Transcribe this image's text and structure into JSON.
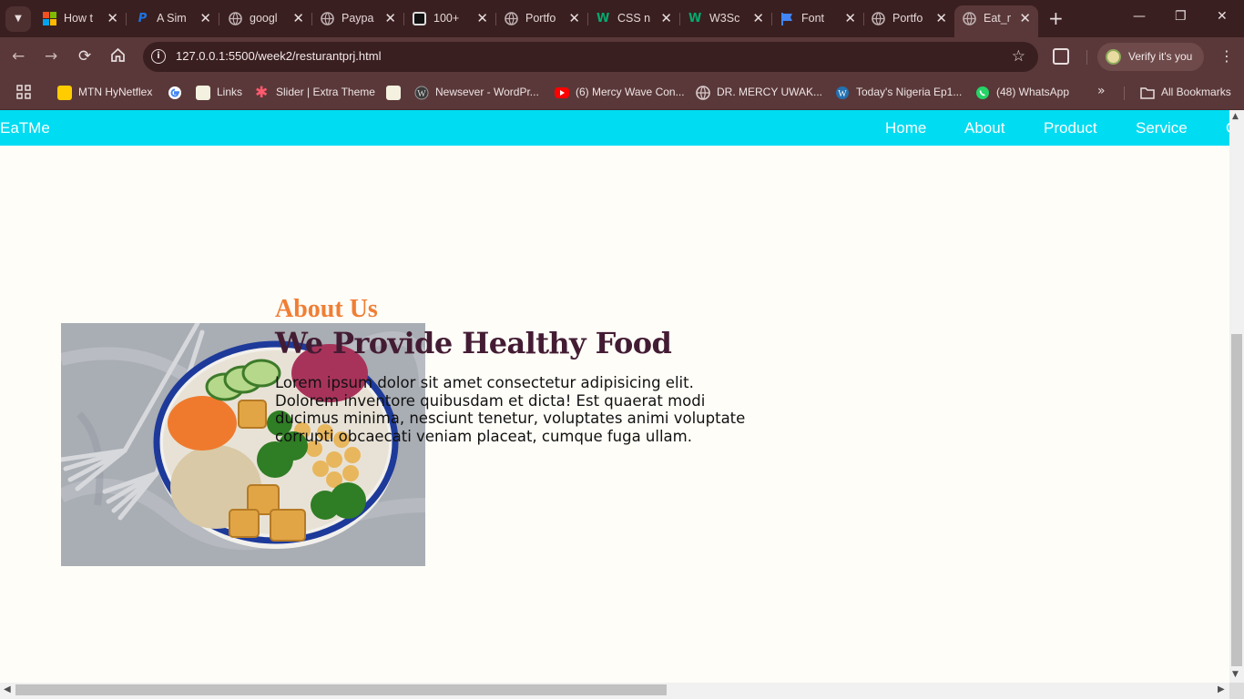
{
  "browser": {
    "tabs": [
      {
        "title": "How t",
        "favicon": "microsoft-icon",
        "color": "#f25022"
      },
      {
        "title": "A Sim",
        "favicon": "paypal-icon",
        "color": "#1b74e4"
      },
      {
        "title": "googl",
        "favicon": "globe-icon",
        "color": "#9e9e9e"
      },
      {
        "title": "Paypa",
        "favicon": "globe-icon",
        "color": "#9e9e9e"
      },
      {
        "title": "100+",
        "favicon": "site-icon",
        "color": "#111111"
      },
      {
        "title": "Portfo",
        "favicon": "globe-icon",
        "color": "#9e9e9e"
      },
      {
        "title": "CSS n",
        "favicon": "w3schools-icon",
        "color": "#04aa6d"
      },
      {
        "title": "W3Sc",
        "favicon": "w3schools-icon",
        "color": "#04aa6d"
      },
      {
        "title": "Font",
        "favicon": "flag-icon",
        "color": "#4285f4"
      },
      {
        "title": "Portfo",
        "favicon": "globe-icon",
        "color": "#9e9e9e"
      },
      {
        "title": "Eat_m",
        "favicon": "globe-icon",
        "color": "#9e9e9e",
        "active": true
      }
    ],
    "url": "127.0.0.1:5500/week2/resturantprj.html",
    "verify_label": "Verify it's you",
    "bookmarks": [
      {
        "label": "MTN HyNetflex",
        "icon": "mtn-icon",
        "color": "#ffcc00"
      },
      {
        "label": "",
        "icon": "google-icon",
        "color": "#ffffff"
      },
      {
        "label": "Links",
        "icon": "page-icon",
        "color": "#f4f1e0"
      },
      {
        "label": "Slider | Extra Theme",
        "icon": "asterisk-icon",
        "color": "#ff5a6e"
      },
      {
        "label": "",
        "icon": "page-icon",
        "color": "#f4f1e0"
      },
      {
        "label": "Newsever - WordPr...",
        "icon": "wordpress-icon",
        "color": "#3a3a3a"
      },
      {
        "label": "(6) Mercy Wave Con...",
        "icon": "youtube-icon",
        "color": "#ff0000"
      },
      {
        "label": "DR. MERCY UWAK...",
        "icon": "globe-icon",
        "color": "#9e9e9e"
      },
      {
        "label": "Today's Nigeria Ep1...",
        "icon": "wordpress-icon",
        "color": "#2271b1"
      },
      {
        "label": "(48) WhatsApp",
        "icon": "whatsapp-icon",
        "color": "#25d366"
      }
    ],
    "all_bookmarks_label": "All Bookmarks"
  },
  "site": {
    "brand": "EaTMe",
    "nav": [
      "Home",
      "About",
      "Product",
      "Service"
    ],
    "nav_accent": "#00dcf2",
    "about_label": "About Us",
    "heading": "We Provide Healthy Food",
    "body": "Lorem ipsum dolor sit amet consectetur adipisicing elit. Dolorem inventore quibusdam et dicta! Est quaerat modi ducimus minima, nesciunt tenetur, voluptates animi voluptate corrupti obcaecati veniam placeat, cumque fuga ullam.",
    "colors": {
      "about_label": "#f07e35",
      "heading": "#431c33"
    }
  }
}
